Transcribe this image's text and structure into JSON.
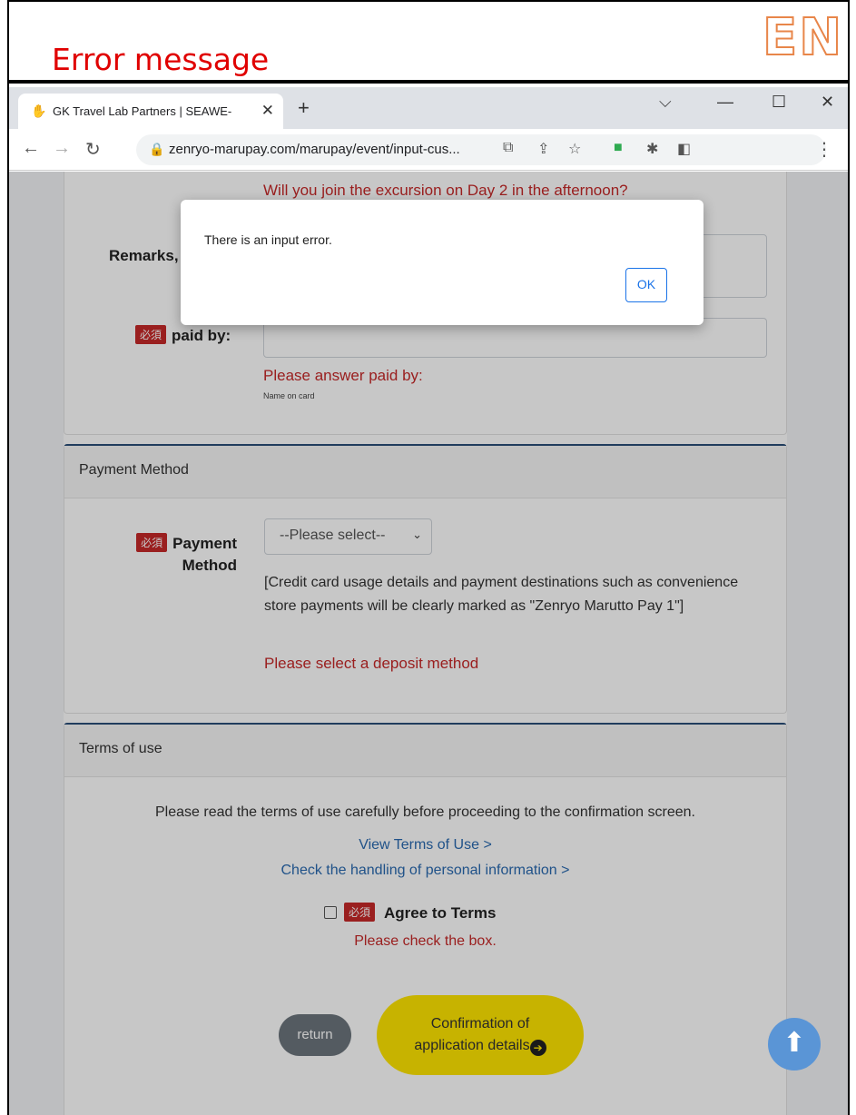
{
  "annotation": {
    "title": "Error message",
    "lang_badge": "EN",
    "title_color": "#e00000",
    "badge_color": "#e8864a"
  },
  "browser": {
    "tab_title": "GK Travel Lab Partners | SEAWE-",
    "tab_close": "✕",
    "new_tab": "+",
    "url": "zenryo-marupay.com/marupay/event/input-cus...",
    "window_controls": [
      "⌵",
      "—",
      "☐",
      "✕"
    ],
    "icons": [
      "back-icon",
      "forward-icon",
      "reload-icon",
      "lock-icon",
      "translate-icon",
      "share-icon",
      "star-icon",
      "extension-green-icon",
      "puzzle-icon",
      "sidepanel-icon",
      "menu-icon"
    ]
  },
  "form": {
    "excursion_error": "Will you join the excursion on Day 2 in the afternoon?",
    "remarks_label": "Remarks,",
    "required_badge": "必須",
    "paid_by_label": "paid by:",
    "paid_by_error": "Please answer paid by:",
    "paid_by_hint": "Name on card"
  },
  "payment": {
    "header": "Payment Method",
    "label_line1": "Payment",
    "label_line2": "Method",
    "select_value": "--Please select--",
    "note": "[Credit card usage details and payment destinations such as convenience store payments will be clearly marked as \"Zenryo Marutto Pay 1\"]",
    "error": "Please select a deposit method"
  },
  "terms": {
    "header": "Terms of use",
    "instruction": "Please read the terms of use carefully before proceeding to the confirmation screen.",
    "view_link": "View Terms of Use >",
    "privacy_link": "Check the handling of personal information >",
    "agree_label": "Agree to Terms",
    "error": "Please check the box."
  },
  "actions": {
    "return_label": "return",
    "confirm_line1": "Confirmation of",
    "confirm_line2": "application details",
    "confirm_color": "#ffe600"
  },
  "dialog": {
    "message": "There is an input error.",
    "ok_label": "OK"
  }
}
